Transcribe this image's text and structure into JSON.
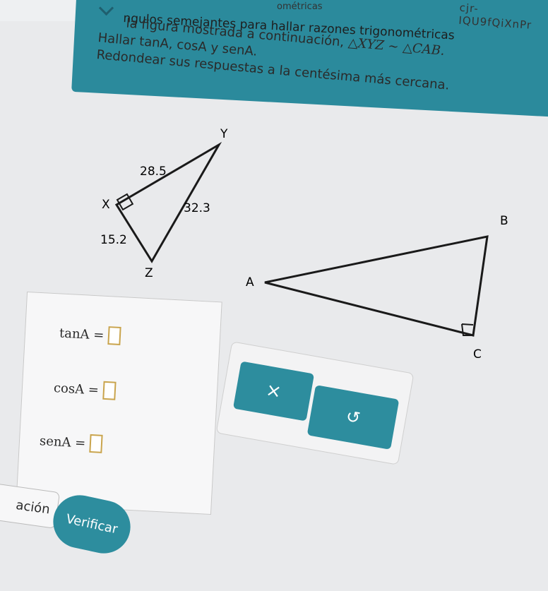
{
  "header": {
    "breadcrumb": "ométricas",
    "code": "cjr-IQU9fQiXnPr",
    "title": "ngulos semejantes para hallar razones trigonométricas"
  },
  "problem": {
    "line1_prefix": "la figura mostrada a continuación,",
    "line1_math": "△XYZ ~ △CAB.",
    "line2": "Hallar tanA, cosA y senA.",
    "line3": "Redondear sus respuestas a la centésima más cercana."
  },
  "triangle_xyz": {
    "vertex_labels": [
      "Y",
      "X",
      "Z"
    ],
    "side_labels": [
      "28.5",
      "32.3",
      "15.2"
    ]
  },
  "triangle_cab": {
    "vertex_labels": [
      "B",
      "A",
      "C"
    ]
  },
  "answers": [
    {
      "label": "tanA =",
      "value": ""
    },
    {
      "label": "cosA =",
      "value": ""
    },
    {
      "label": "senA =",
      "value": ""
    }
  ],
  "buttons": {
    "clear_icon": "×",
    "undo_icon": "↺",
    "verify": "Verificar",
    "left_partial": "ación"
  },
  "colors": {
    "accent": "#2d8d9e",
    "slot_border": "#c9a44d"
  }
}
